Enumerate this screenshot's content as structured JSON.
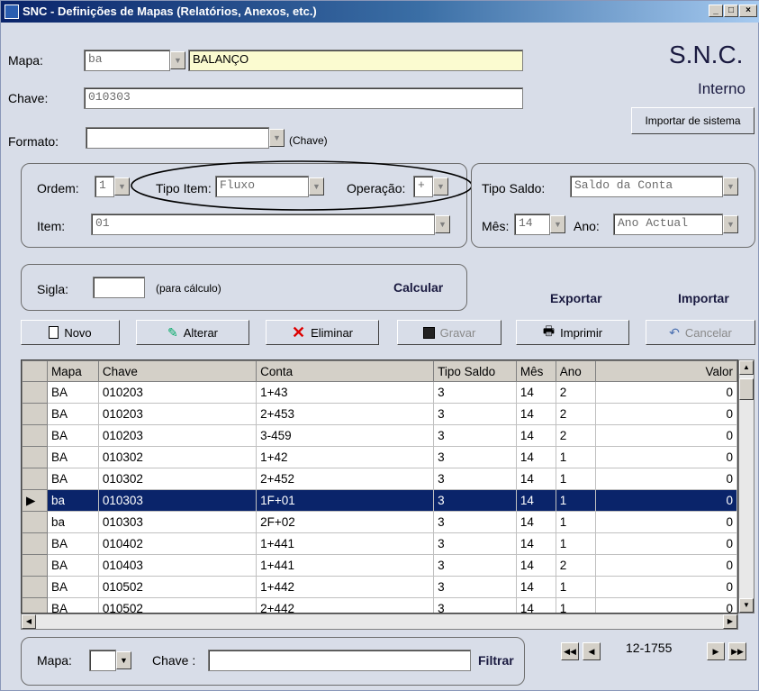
{
  "window": {
    "title": "SNC - Definições de Mapas (Relatórios, Anexos, etc.)"
  },
  "header": {
    "mapa_label": "Mapa:",
    "mapa_code": "ba",
    "mapa_name": "BALANÇO",
    "chave_label": "Chave:",
    "chave_value": "010303",
    "formato_label": "Formato:",
    "formato_value": "",
    "formato_hint": "(Chave)",
    "brand": "S.N.C.",
    "brand_sub": "Interno",
    "import_system_label": "Importar de sistema"
  },
  "criteria": {
    "ordem_label": "Ordem:",
    "ordem_value": "1",
    "tipo_item_label": "Tipo Item:",
    "tipo_item_value": "Fluxo",
    "operacao_label": "Operação:",
    "operacao_value": "+",
    "item_label": "Item:",
    "item_value": "01",
    "tipo_saldo_label": "Tipo Saldo:",
    "tipo_saldo_value": "Saldo da Conta",
    "mes_label": "Mês:",
    "mes_value": "14",
    "ano_label": "Ano:",
    "ano_value": "Ano Actual"
  },
  "sigla": {
    "label": "Sigla:",
    "value": "",
    "hint": "(para cálculo)",
    "calc_label": "Calcular"
  },
  "actions": {
    "exportar": "Exportar",
    "importar": "Importar"
  },
  "toolbar": {
    "novo": "Novo",
    "alterar": "Alterar",
    "eliminar": "Eliminar",
    "gravar": "Gravar",
    "imprimir": "Imprimir",
    "cancelar": "Cancelar"
  },
  "table": {
    "columns": [
      "Mapa",
      "Chave",
      "Conta",
      "Tipo Saldo",
      "Mês",
      "Ano",
      "Valor"
    ],
    "rows": [
      [
        "BA",
        "010203",
        "1+43",
        "3",
        "14",
        "2",
        "0"
      ],
      [
        "BA",
        "010203",
        "2+453",
        "3",
        "14",
        "2",
        "0"
      ],
      [
        "BA",
        "010203",
        "3-459",
        "3",
        "14",
        "2",
        "0"
      ],
      [
        "BA",
        "010302",
        "1+42",
        "3",
        "14",
        "1",
        "0"
      ],
      [
        "BA",
        "010302",
        "2+452",
        "3",
        "14",
        "1",
        "0"
      ],
      [
        "ba",
        "010303",
        "1F+01",
        "3",
        "14",
        "1",
        "0"
      ],
      [
        "ba",
        "010303",
        "2F+02",
        "3",
        "14",
        "1",
        "0"
      ],
      [
        "BA",
        "010402",
        "1+441",
        "3",
        "14",
        "1",
        "0"
      ],
      [
        "BA",
        "010403",
        "1+441",
        "3",
        "14",
        "2",
        "0"
      ],
      [
        "BA",
        "010502",
        "1+442",
        "3",
        "14",
        "1",
        "0"
      ],
      [
        "BA",
        "010502",
        "2+442",
        "3",
        "14",
        "1",
        "0"
      ]
    ],
    "selected_row": 5
  },
  "filter": {
    "mapa_label": "Mapa:",
    "mapa_value": "",
    "chave_label": "Chave :",
    "chave_value": "",
    "filtrar_label": "Filtrar"
  },
  "pager": {
    "position": "12-1755"
  }
}
